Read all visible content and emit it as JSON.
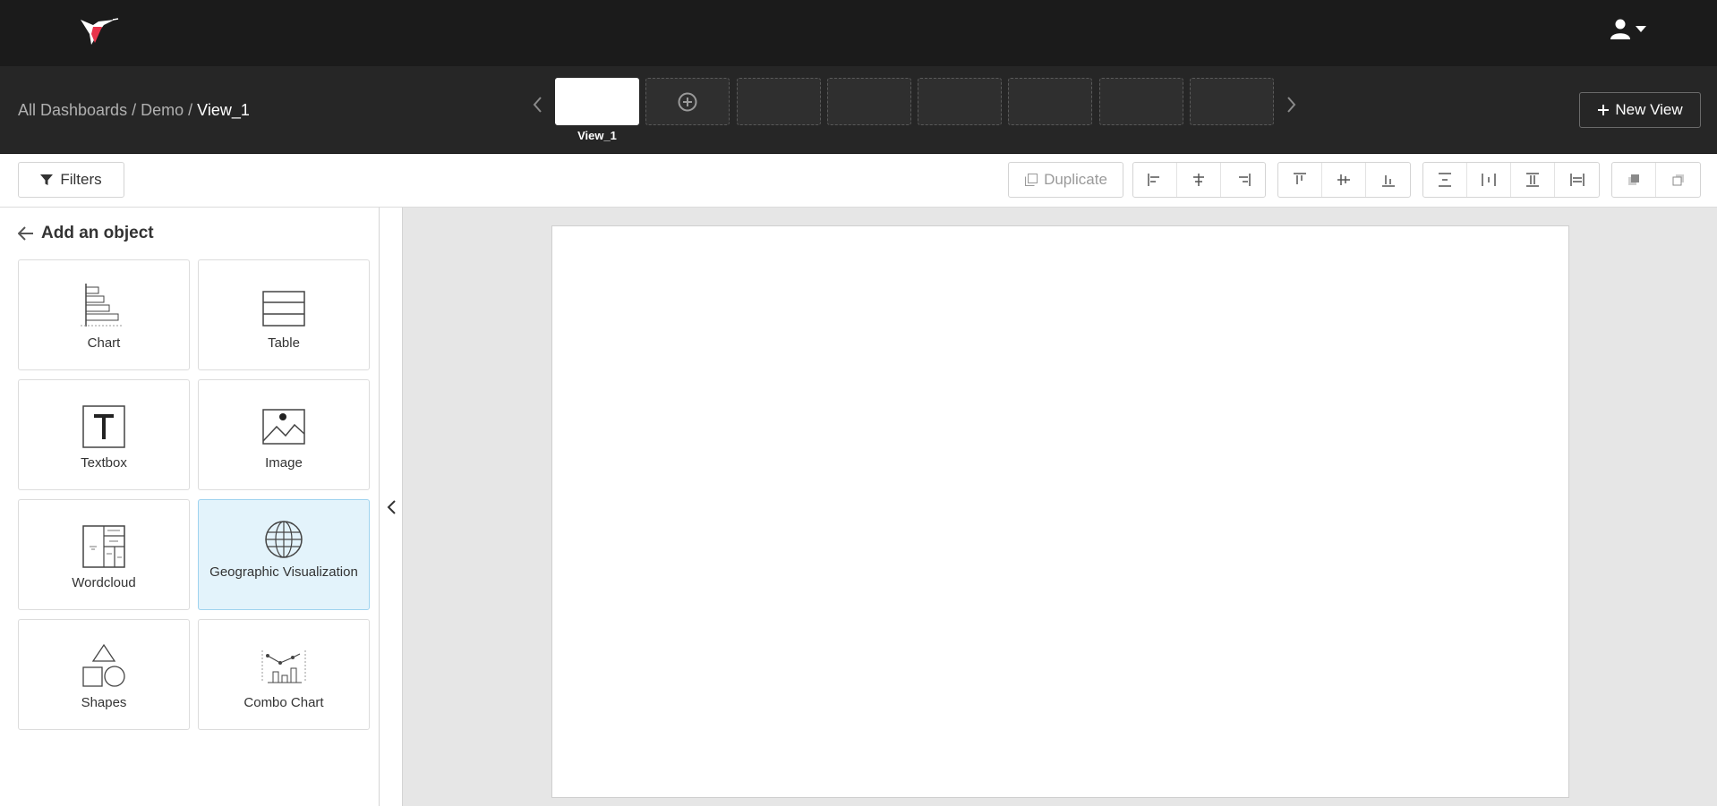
{
  "header": {
    "logo_icon": "hummingbird-logo-icon",
    "user_icon": "user-icon",
    "dropdown_icon": "caret-down-icon"
  },
  "breadcrumb": {
    "root": "All Dashboards",
    "sep1": "/",
    "dashboard": "Demo",
    "sep2": "/",
    "current": "View_1"
  },
  "views": {
    "active_label": "View_1",
    "add_icon": "plus-circle-icon",
    "prev_icon": "chevron-left-icon",
    "next_icon": "chevron-right-icon",
    "new_view_label": "New View"
  },
  "toolbar": {
    "filters_label": "Filters",
    "duplicate_label": "Duplicate"
  },
  "panel": {
    "title": "Add an object",
    "objects": [
      {
        "label": "Chart",
        "icon": "bar-chart-icon"
      },
      {
        "label": "Table",
        "icon": "table-icon"
      },
      {
        "label": "Textbox",
        "icon": "textbox-icon"
      },
      {
        "label": "Image",
        "icon": "image-icon"
      },
      {
        "label": "Wordcloud",
        "icon": "wordcloud-icon"
      },
      {
        "label": "Geographic Visualization",
        "icon": "globe-icon"
      },
      {
        "label": "Shapes",
        "icon": "shapes-icon"
      },
      {
        "label": "Combo Chart",
        "icon": "combo-chart-icon"
      }
    ],
    "selected": "Geographic Visualization"
  },
  "colors": {
    "topbar": "#1b1b1b",
    "viewbar": "#262626",
    "logo_accent": "#e8334a",
    "selected_tile": "#e3f3fb",
    "canvas_bg": "#e6e6e6"
  }
}
